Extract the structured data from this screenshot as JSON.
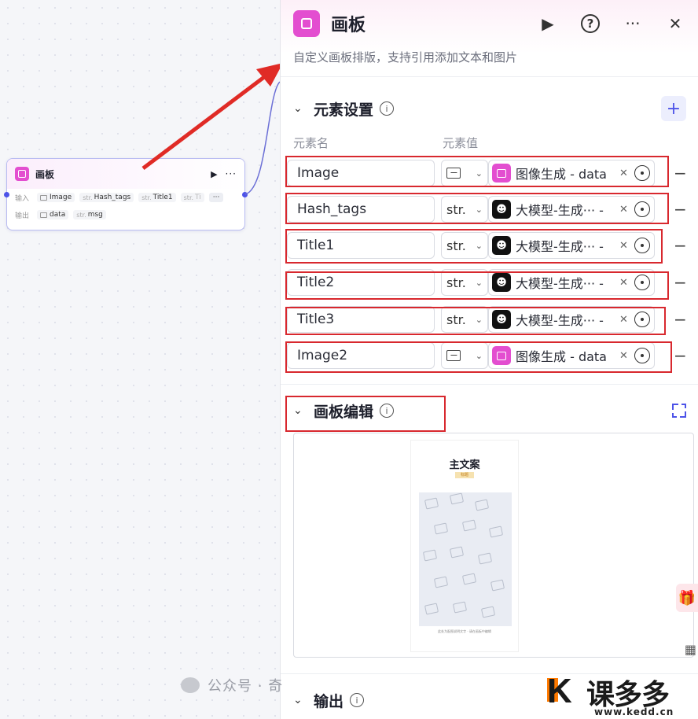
{
  "node": {
    "title": "画板",
    "input_label": "输入",
    "output_label": "输出",
    "inputs": [
      {
        "type": "",
        "name": "Image",
        "img": true
      },
      {
        "type": "str.",
        "name": "Hash_tags"
      },
      {
        "type": "str.",
        "name": "Title1"
      },
      {
        "type": "str.",
        "name": "Ti",
        "faded": true
      }
    ],
    "more": "···",
    "outputs": [
      {
        "type": "",
        "name": "data",
        "img": true
      },
      {
        "type": "str.",
        "name": "msg"
      }
    ]
  },
  "panel": {
    "title": "画板",
    "description": "自定义画板排版，支持引用添加文本和图片",
    "help_icon": "?",
    "more_icon": "···",
    "close_icon": "✕",
    "play_icon": "▶"
  },
  "elements_section": {
    "title": "元素设置",
    "col_name": "元素名",
    "col_value": "元素值",
    "add_label": "+",
    "rows": [
      {
        "name": "Image",
        "type": "image",
        "ref_icon": "pink",
        "ref": "图像生成 - data"
      },
      {
        "name": "Hash_tags",
        "type": "str.",
        "ref_icon": "black",
        "ref": "大模型-生成··· -"
      },
      {
        "name": "Title1",
        "type": "str.",
        "ref_icon": "black",
        "ref": "大模型-生成··· -"
      },
      {
        "name": "Title2",
        "type": "str.",
        "ref_icon": "black",
        "ref": "大模型-生成··· -"
      },
      {
        "name": "Title3",
        "type": "str.",
        "ref_icon": "black",
        "ref": "大模型-生成··· -"
      },
      {
        "name": "Image2",
        "type": "image",
        "ref_icon": "pink",
        "ref": "图像生成 - data"
      }
    ]
  },
  "canvas_section": {
    "title": "画板编辑",
    "poster_title": "主文案",
    "poster_sub": "标题",
    "poster_caption": "此处为配图说明文字 · 请在画板中编辑"
  },
  "output_section": {
    "title": "输出"
  },
  "watermark": {
    "text": "公众号 · 奇",
    "logo_cn": "课多多",
    "logo_url": "www.kedd.cn"
  },
  "colors": {
    "accent": "#4d53e8",
    "brand_pink": "#e34ed0",
    "highlight_red": "#d8282e"
  }
}
